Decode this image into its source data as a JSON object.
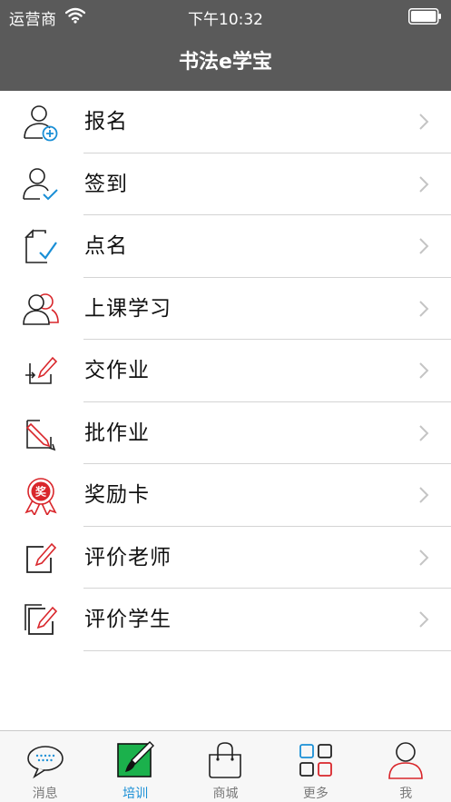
{
  "status_bar": {
    "carrier": "运营商",
    "time": "下午10:32"
  },
  "nav": {
    "title": "书法e学宝"
  },
  "menu": {
    "items": [
      {
        "label": "报名",
        "icon": "register-person-add-icon"
      },
      {
        "label": "签到",
        "icon": "check-in-person-icon"
      },
      {
        "label": "点名",
        "icon": "roll-call-document-check-icon"
      },
      {
        "label": "上课学习",
        "icon": "class-study-people-icon"
      },
      {
        "label": "交作业",
        "icon": "submit-homework-icon"
      },
      {
        "label": "批作业",
        "icon": "grade-homework-icon"
      },
      {
        "label": "奖励卡",
        "icon": "award-rosette-icon",
        "badge_text": "奖"
      },
      {
        "label": "评价老师",
        "icon": "rate-teacher-edit-icon"
      },
      {
        "label": "评价学生",
        "icon": "rate-student-edit-icon"
      }
    ]
  },
  "tabbar": {
    "active_index": 1,
    "tabs": [
      {
        "label": "消息",
        "icon": "chat-bubble-icon"
      },
      {
        "label": "培训",
        "icon": "brush-training-icon"
      },
      {
        "label": "商城",
        "icon": "shopping-bag-icon"
      },
      {
        "label": "更多",
        "icon": "grid-more-icon"
      },
      {
        "label": "我",
        "icon": "person-profile-icon"
      }
    ]
  },
  "colors": {
    "nav_background": "#5a5a5a",
    "accent_blue": "#1a8fd6",
    "accent_red": "#d9262b",
    "active_tab_green": "#1bb14c",
    "divider": "#d4d4d4"
  }
}
